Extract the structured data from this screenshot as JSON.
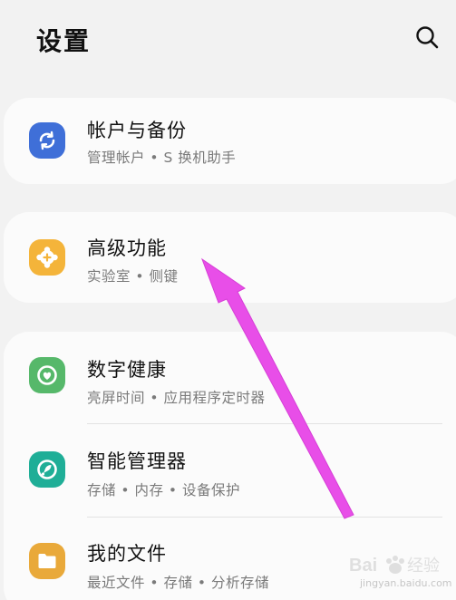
{
  "header": {
    "title": "设置",
    "search_icon": "search-icon"
  },
  "items": [
    {
      "title": "帐户与备份",
      "subtitle": "管理帐户 • S 换机助手",
      "icon": "sync-icon",
      "icon_color": "#3f6fd8"
    },
    {
      "title": "高级功能",
      "subtitle": "实验室 • 侧键",
      "icon": "gear-plus-icon",
      "icon_color": "#f4b43a"
    },
    {
      "title": "数字健康",
      "subtitle": "亮屏时间 • 应用程序定时器",
      "icon": "wellbeing-icon",
      "icon_color": "#56b86a"
    },
    {
      "title": "智能管理器",
      "subtitle": "存储 • 内存 • 设备保护",
      "icon": "device-care-icon",
      "icon_color": "#1fae97"
    },
    {
      "title": "我的文件",
      "subtitle": "最近文件 • 存储 • 分析存储",
      "icon": "folder-icon",
      "icon_color": "#e9a93a"
    }
  ],
  "annotation": {
    "arrow_color": "#e84ee8"
  },
  "watermark": {
    "text": "Bai 经验",
    "url": "jingyan.baidu.com"
  }
}
